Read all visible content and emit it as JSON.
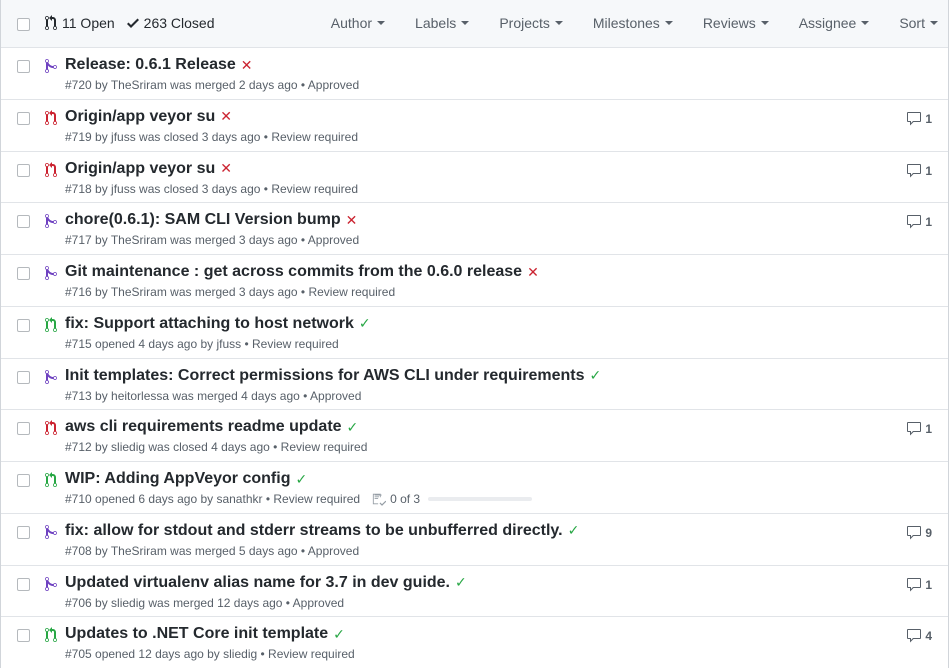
{
  "header": {
    "open_label": "11 Open",
    "closed_label": "263 Closed",
    "filters": [
      "Author",
      "Labels",
      "Projects",
      "Milestones",
      "Reviews",
      "Assignee",
      "Sort"
    ]
  },
  "colors": {
    "merged": "#6f42c1",
    "closed": "#cb2431",
    "open": "#28a745"
  },
  "pulls": [
    {
      "state": "merged",
      "title": "Release: 0.6.1 Release",
      "status": "fail",
      "meta": "#720 by TheSriram was merged 2 days ago • Approved",
      "comments": ""
    },
    {
      "state": "closed",
      "title": "Origin/app veyor su",
      "status": "fail",
      "meta": "#719 by jfuss was closed 3 days ago • Review required",
      "comments": "1"
    },
    {
      "state": "closed",
      "title": "Origin/app veyor su",
      "status": "fail",
      "meta": "#718 by jfuss was closed 3 days ago • Review required",
      "comments": "1"
    },
    {
      "state": "merged",
      "title": "chore(0.6.1): SAM CLI Version bump",
      "status": "fail",
      "meta": "#717 by TheSriram was merged 3 days ago • Approved",
      "comments": "1"
    },
    {
      "state": "merged",
      "title": "Git maintenance : get across commits from the 0.6.0 release",
      "status": "fail",
      "meta": "#716 by TheSriram was merged 3 days ago • Review required",
      "comments": ""
    },
    {
      "state": "open",
      "title": "fix: Support attaching to host network",
      "status": "ok",
      "meta": "#715 opened 4 days ago by jfuss • Review required",
      "comments": ""
    },
    {
      "state": "merged",
      "title": "Init templates: Correct permissions for AWS CLI under requirements",
      "status": "ok",
      "meta": "#713 by heitorlessa was merged 4 days ago • Approved",
      "comments": ""
    },
    {
      "state": "closed",
      "title": "aws cli requirements readme update",
      "status": "ok",
      "meta": "#712 by sliedig was closed 4 days ago • Review required",
      "comments": "1"
    },
    {
      "state": "open",
      "title": "WIP: Adding AppVeyor config",
      "status": "ok",
      "meta": "#710 opened 6 days ago by sanathkr • Review required",
      "comments": "",
      "tasks": "0 of 3",
      "task_progress": 0
    },
    {
      "state": "merged",
      "title": "fix: allow for stdout and stderr streams to be unbufferred directly.",
      "status": "ok",
      "meta": "#708 by TheSriram was merged 5 days ago • Approved",
      "comments": "9"
    },
    {
      "state": "merged",
      "title": "Updated virtualenv alias name for 3.7 in dev guide.",
      "status": "ok",
      "meta": "#706 by sliedig was merged 12 days ago • Approved",
      "comments": "1"
    },
    {
      "state": "open",
      "title": "Updates to .NET Core init template",
      "status": "ok",
      "meta": "#705 opened 12 days ago by sliedig • Review required",
      "comments": "4"
    }
  ]
}
